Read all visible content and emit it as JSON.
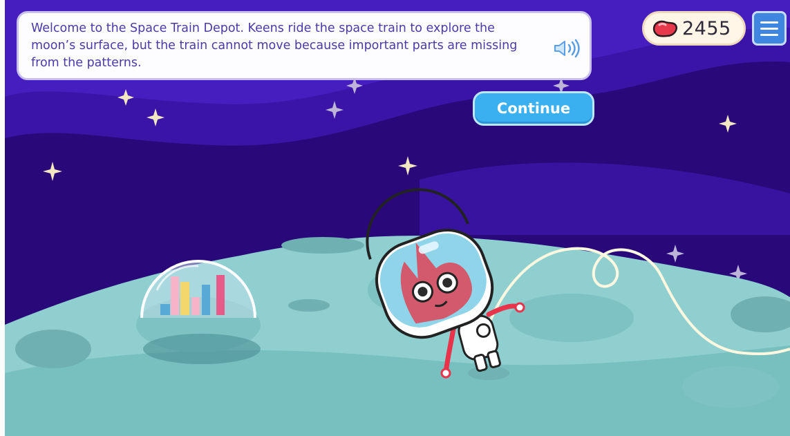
{
  "dialog": {
    "text": "Welcome to the Space Train Depot. Keens ride the space train to explore the moon’s surface, but the train cannot move because important parts are missing from the patterns."
  },
  "continue_button": {
    "label": "Continue"
  },
  "beans": {
    "count": "2455",
    "icon": "jellybean-icon"
  },
  "menu": {
    "icon": "hamburger-menu-icon"
  },
  "icons": {
    "speaker": "speaker-icon"
  },
  "colors": {
    "sky": "#2b0c7a",
    "moon": "#8ccfd0",
    "dialog_text": "#4b3aa8",
    "continue": "#3ab0f0",
    "menu": "#3f86e0",
    "bean": "#e63a4c"
  }
}
